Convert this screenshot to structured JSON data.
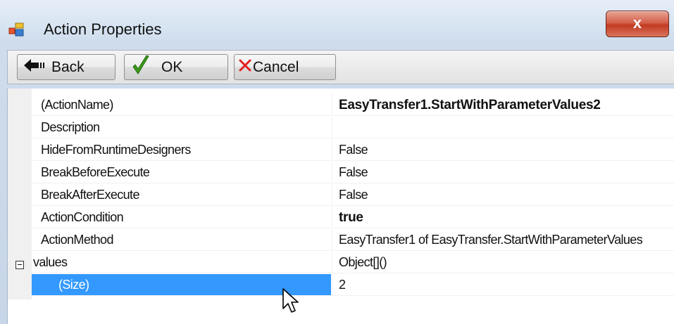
{
  "window": {
    "title": "Action Properties",
    "close_label": "x"
  },
  "toolbar": {
    "back_label": "Back",
    "ok_label": "OK",
    "cancel_label": "Cancel"
  },
  "properties": [
    {
      "name": "(ActionName)",
      "value": "EasyTransfer1.StartWithParameterValues2",
      "bold": true
    },
    {
      "name": "Description",
      "value": ""
    },
    {
      "name": "HideFromRuntimeDesigners",
      "value": "False"
    },
    {
      "name": "BreakBeforeExecute",
      "value": "False"
    },
    {
      "name": "BreakAfterExecute",
      "value": "False"
    },
    {
      "name": "ActionCondition",
      "value": "true",
      "bold": true
    },
    {
      "name": "ActionMethod",
      "value": "EasyTransfer1 of EasyTransfer.StartWithParameterValues"
    },
    {
      "name": "values",
      "value": "Object[]()"
    },
    {
      "name": "(Size)",
      "value": "2",
      "selected": true
    }
  ],
  "colors": {
    "selection": "#3399ff",
    "close_button": "#c23b22",
    "ok_check": "#3a9a1a",
    "cancel_x": "#e02020"
  },
  "icons": {
    "app": "properties-window-icon",
    "back": "back-arrow-icon",
    "ok": "green-check-icon",
    "cancel": "red-x-icon",
    "expander": "collapse-minus-icon",
    "cursor": "mouse-pointer-icon"
  }
}
